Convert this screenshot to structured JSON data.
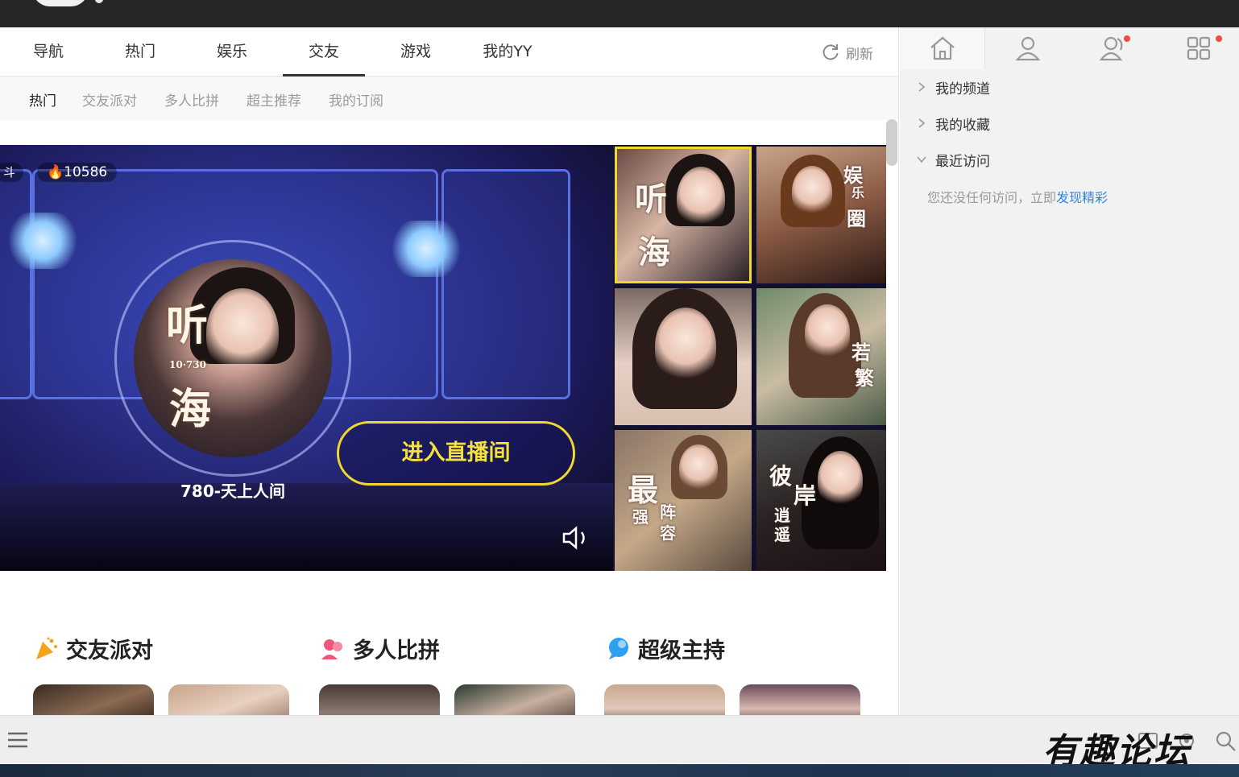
{
  "nav": {
    "tabs": [
      {
        "label": "导航"
      },
      {
        "label": "热门"
      },
      {
        "label": "娱乐"
      },
      {
        "label": "交友"
      },
      {
        "label": "游戏"
      },
      {
        "label": "我的YY"
      }
    ],
    "active_tab": "交友",
    "refresh_label": "刷新"
  },
  "subnav": {
    "tabs": [
      {
        "label": "热门"
      },
      {
        "label": "交友派对"
      },
      {
        "label": "多人比拼"
      },
      {
        "label": "超主推荐"
      },
      {
        "label": "我的订阅"
      }
    ],
    "active_tab": "热门"
  },
  "banner": {
    "corner_tag": "斗",
    "heat_count": "10586",
    "calligraphy_main": [
      "听",
      "海"
    ],
    "calligraphy_small": "10·730",
    "room_name": "780-天上人间",
    "enter_button": "进入直播间",
    "thumbnails": [
      {
        "text": [
          "听",
          "海"
        ],
        "selected": true
      },
      {
        "text": [
          "娱",
          "乐",
          "圈"
        ],
        "selected": false
      },
      {
        "text": [],
        "selected": false
      },
      {
        "text": [
          "若",
          "繁"
        ],
        "selected": false
      },
      {
        "text": [
          "最",
          "强",
          "阵",
          "容"
        ],
        "selected": false
      },
      {
        "text": [
          "彼",
          "岸",
          "逍",
          "遥"
        ],
        "selected": false
      }
    ]
  },
  "sections": [
    {
      "title": "交友派对",
      "icon": "party-popper-icon",
      "color": "#f7a21b"
    },
    {
      "title": "多人比拼",
      "icon": "people-icon",
      "color": "#f0567a"
    },
    {
      "title": "超级主持",
      "icon": "chat-bubble-icon",
      "color": "#2f9ff0"
    }
  ],
  "sidebar": {
    "items": [
      {
        "label": "我的频道",
        "expanded": false
      },
      {
        "label": "我的收藏",
        "expanded": false
      },
      {
        "label": "最近访问",
        "expanded": true
      }
    ],
    "empty_text": "您还没任何访问，立即",
    "empty_link": "发现精彩"
  },
  "watermark": "有趣论坛",
  "colors": {
    "accent_yellow": "#f2d82a",
    "link_blue": "#2f86e6",
    "notify_red": "#f04a3a"
  }
}
